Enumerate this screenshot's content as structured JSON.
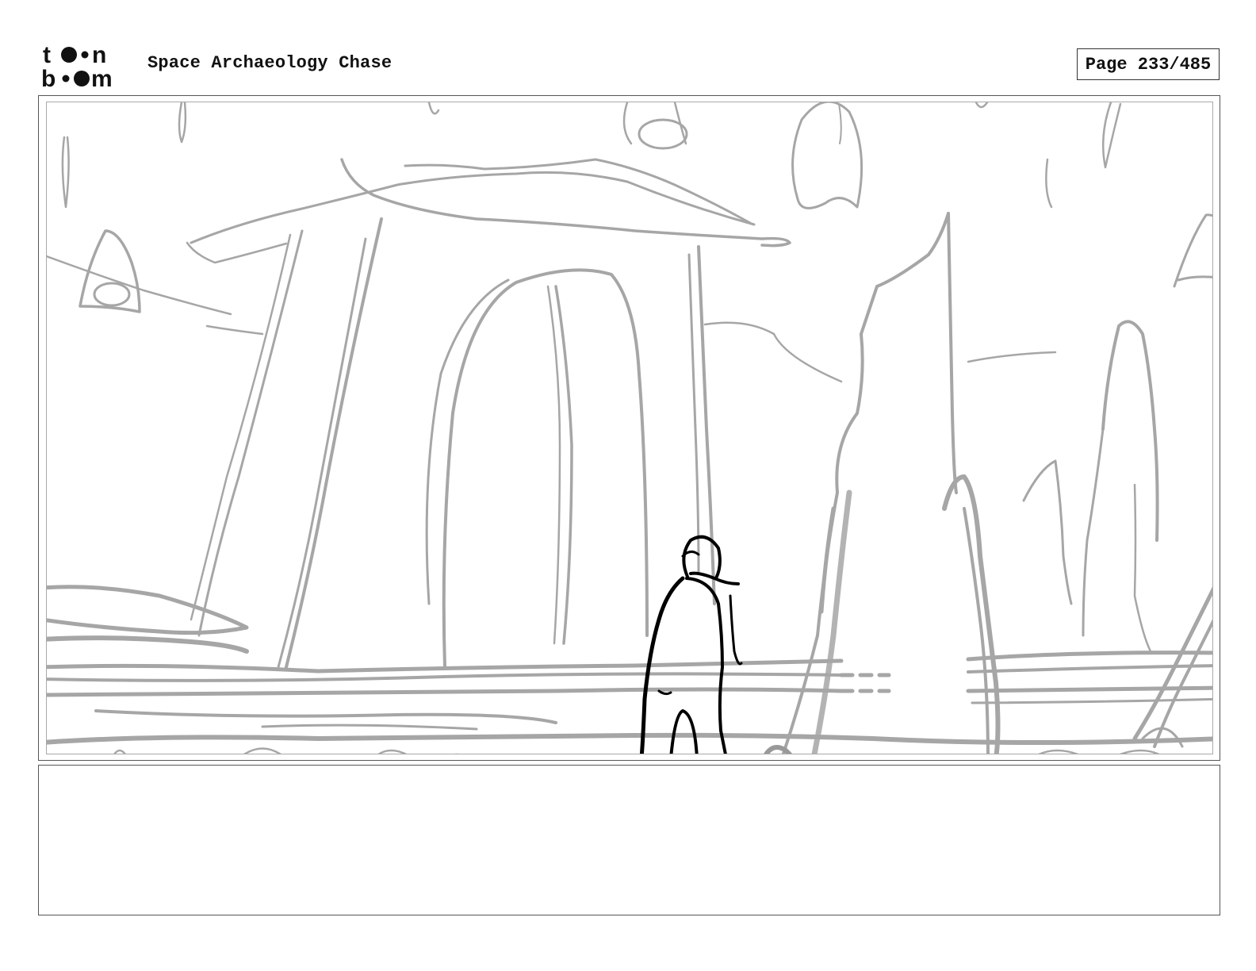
{
  "header": {
    "logo_text": [
      "to•n",
      "b•om"
    ],
    "project_title": "Space Archaeology Chase",
    "page_indicator": "Page 233/485"
  },
  "panel": {
    "sketch_ink_color": "#a6a6a6",
    "character_ink_color": "#000000"
  },
  "notes": {
    "text": ""
  }
}
